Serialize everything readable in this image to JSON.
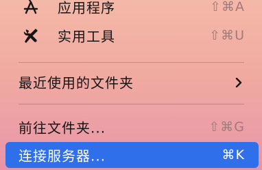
{
  "menu": {
    "items": [
      {
        "label": "应用程序",
        "shortcut": "⇧⌘A",
        "icon": "applications-icon"
      },
      {
        "label": "实用工具",
        "shortcut": "⇧⌘U",
        "icon": "utilities-icon"
      },
      {
        "label": "最近使用的文件夹",
        "has_submenu": true,
        "icon": "chevron-right-icon"
      },
      {
        "label": "前往文件夹...",
        "shortcut": "⇧⌘G"
      },
      {
        "label": "连接服务器...",
        "shortcut": "⌘K",
        "selected": true
      }
    ]
  },
  "colors": {
    "selection": "#2f6fea",
    "text": "#151515",
    "shortcut_text": "#a07a7a"
  }
}
